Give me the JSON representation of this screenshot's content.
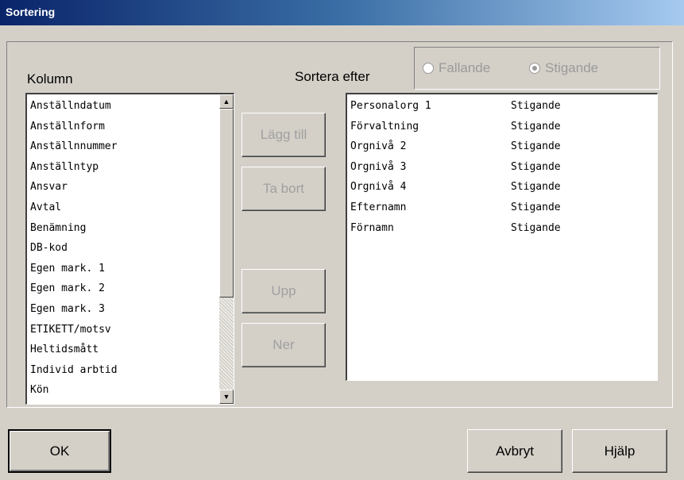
{
  "window": {
    "title": "Sortering"
  },
  "labels": {
    "column": "Kolumn",
    "sort_by": "Sortera efter"
  },
  "order": {
    "options": [
      {
        "label": "Fallande",
        "selected": false
      },
      {
        "label": "Stigande",
        "selected": true
      }
    ]
  },
  "columns_list": {
    "items": [
      "Anställndatum",
      "Anställnform",
      "Anställnnummer",
      "Anställntyp",
      "Ansvar",
      "Avtal",
      "Benämning",
      "DB-kod",
      "Egen mark. 1",
      "Egen mark. 2",
      "Egen mark. 3",
      "ETIKETT/motsv",
      "Heltidsmått",
      "Individ arbtid",
      "Kön"
    ]
  },
  "sort_list": {
    "items": [
      {
        "column": "Personalorg 1",
        "order": "Stigande"
      },
      {
        "column": "Förvaltning",
        "order": "Stigande"
      },
      {
        "column": "Orgnivå 2",
        "order": "Stigande"
      },
      {
        "column": "Orgnivå 3",
        "order": "Stigande"
      },
      {
        "column": "Orgnivå 4",
        "order": "Stigande"
      },
      {
        "column": "Efternamn",
        "order": "Stigande"
      },
      {
        "column": "Förnamn",
        "order": "Stigande"
      }
    ]
  },
  "actions": {
    "add": "Lägg till",
    "remove": "Ta bort",
    "up": "Upp",
    "down": "Ner"
  },
  "footer": {
    "ok": "OK",
    "cancel": "Avbryt",
    "help": "Hjälp"
  },
  "icons": {
    "scroll_up": "arrow-up-icon",
    "scroll_down": "arrow-down-icon"
  }
}
